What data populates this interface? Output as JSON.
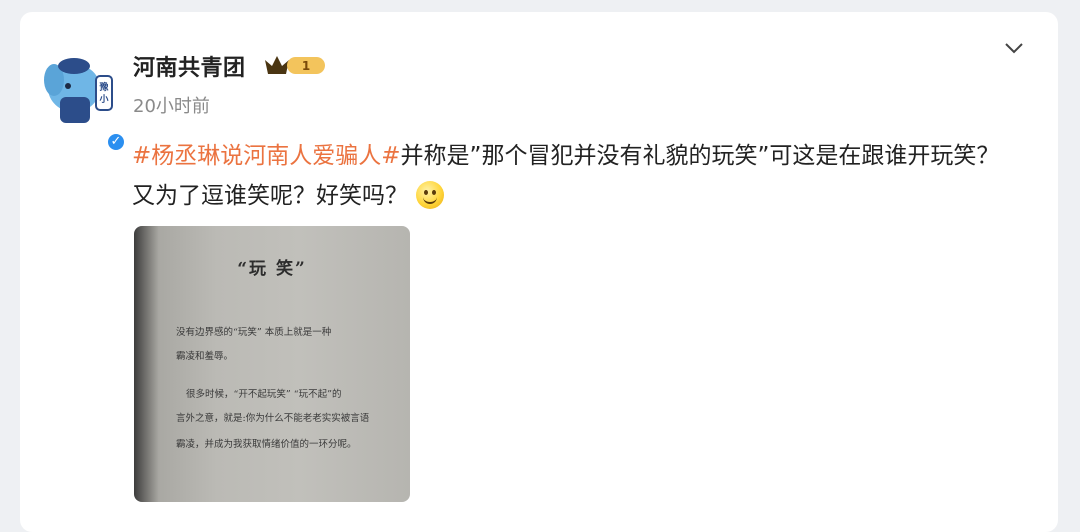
{
  "post": {
    "username": "河南共青团",
    "level_badge": "1",
    "timestamp": "20小时前",
    "verified_mark": "✓",
    "topic": "#杨丞琳说河南人爱骗人#",
    "text": "并称是”那个冒犯并没有礼貌的玩笑”可这是在跟谁开玩笑？又为了逗谁笑呢？好笑吗？",
    "emoji": "smile-emoji"
  },
  "image_text": {
    "title": "“玩 笑”",
    "lines": [
      "没有边界感的“玩笑” 本质上就是一种",
      "霸凌和羞辱。",
      "很多时候，“开不起玩笑” “玩不起”的",
      "言外之意，就是:你为什么不能老老实实被言语",
      "霸凌，并成为我获取情绪价值的一环分呢。"
    ]
  },
  "colors": {
    "topic": "#eb7340",
    "verified": "#2b8ff0",
    "badge": "#e9a42a"
  }
}
